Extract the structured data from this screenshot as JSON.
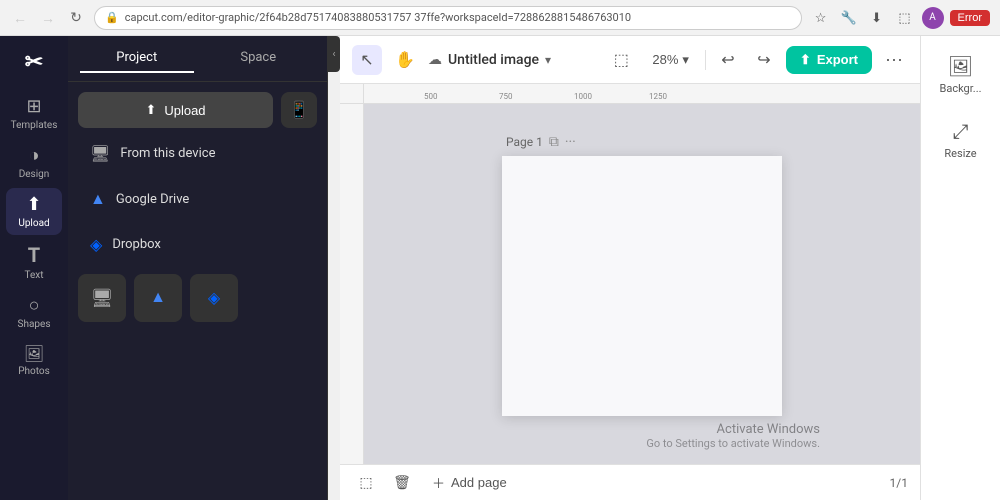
{
  "browser": {
    "url": "capcut.com/editor-graphic/2f64b28d75174083880531757 37ffe?workspaceId=7288628815486763010",
    "error_label": "Error",
    "back_title": "Back",
    "forward_title": "Forward",
    "reload_title": "Reload"
  },
  "app": {
    "logo_symbol": "✂",
    "panel": {
      "tab_project": "Project",
      "tab_space": "Space",
      "upload_button": "Upload",
      "upload_icon_title": "Mobile",
      "sources": [
        {
          "id": "device",
          "label": "From this device",
          "icon": "🖥"
        },
        {
          "id": "gdrive",
          "label": "Google Drive",
          "icon": "△"
        },
        {
          "id": "dropbox",
          "label": "Dropbox",
          "icon": "◈"
        }
      ],
      "shortcut_device_title": "Device",
      "shortcut_gdrive_title": "Google Drive",
      "shortcut_dropbox_title": "Dropbox"
    },
    "sidebar": {
      "items": [
        {
          "id": "templates",
          "label": "Templates",
          "icon": "⊞"
        },
        {
          "id": "design",
          "label": "Design",
          "icon": "◑"
        },
        {
          "id": "upload",
          "label": "Upload",
          "icon": "⬆",
          "active": true
        },
        {
          "id": "text",
          "label": "Text",
          "icon": "T"
        },
        {
          "id": "shapes",
          "label": "Shapes",
          "icon": "○"
        },
        {
          "id": "photos",
          "label": "Photos",
          "icon": "🖼"
        }
      ]
    },
    "toolbar": {
      "cloud_icon": "☁",
      "title": "Untitled image",
      "chevron": "▾",
      "cursor_tool": "↖",
      "hand_tool": "✋",
      "frame_tool": "⬜",
      "zoom_level": "28%",
      "zoom_chevron": "▾",
      "undo": "↩",
      "redo": "↪",
      "export_icon": "⬆",
      "export_label": "Export",
      "more_icon": "···"
    },
    "canvas": {
      "page_label": "Page 1",
      "ruler_marks": [
        "500",
        "750",
        "1000",
        "1250"
      ],
      "activate_title": "Activate Windows",
      "activate_sub": "Go to Settings to activate Windows."
    },
    "footer": {
      "add_page_label": "Add page",
      "page_count": "1/1"
    },
    "right_panel": {
      "items": [
        {
          "id": "background",
          "label": "Backgr...",
          "icon": "🖼"
        },
        {
          "id": "resize",
          "label": "Resize",
          "icon": "⤢"
        }
      ]
    }
  }
}
